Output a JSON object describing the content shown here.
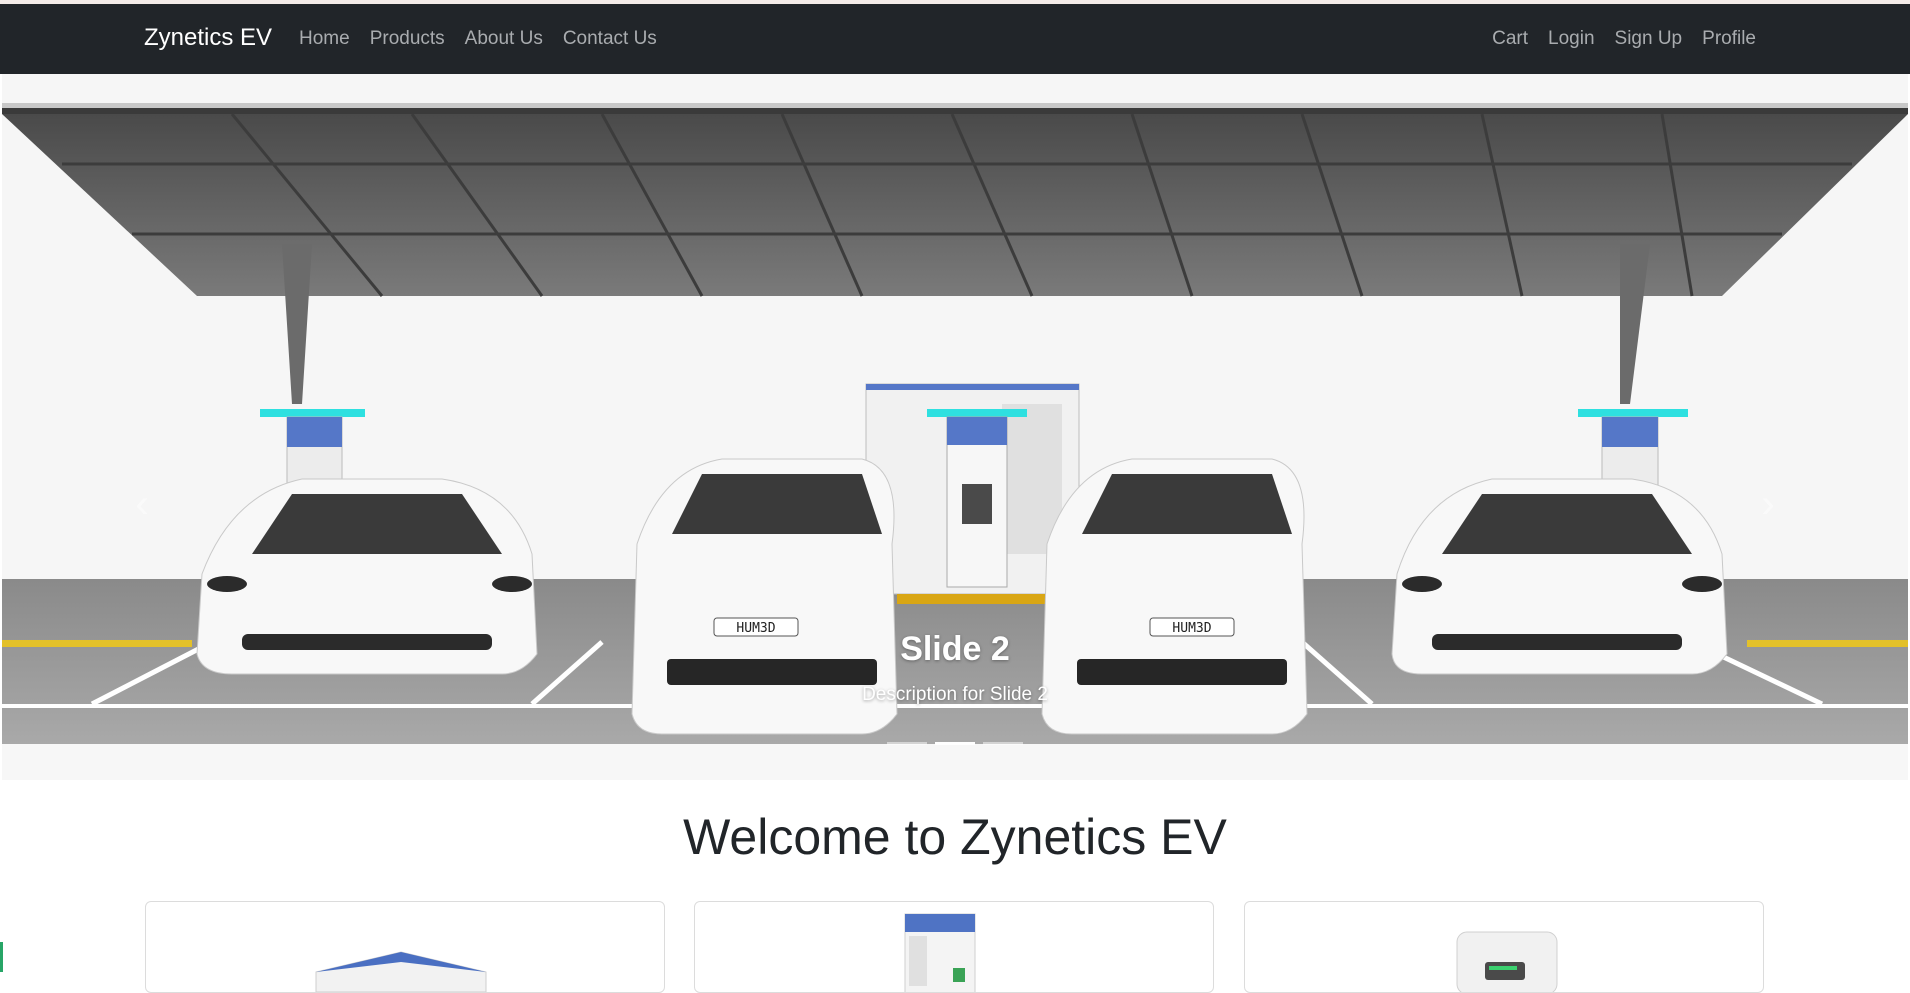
{
  "brand": "Zynetics EV",
  "nav": {
    "left": [
      "Home",
      "Products",
      "About Us",
      "Contact Us"
    ],
    "right": [
      "Cart",
      "Login",
      "Sign Up",
      "Profile"
    ]
  },
  "carousel": {
    "slide_title": "Slide 2",
    "slide_description": "Description for Slide 2",
    "plate_text": "HUM3D",
    "indicator_count": 3,
    "active_index": 1
  },
  "welcome_heading": "Welcome to Zynetics EV",
  "colors": {
    "navbar": "#212529",
    "nav_link": "#a9acaf",
    "charger_accent": "#2ee0e0",
    "charger_blue": "#5577c8"
  }
}
